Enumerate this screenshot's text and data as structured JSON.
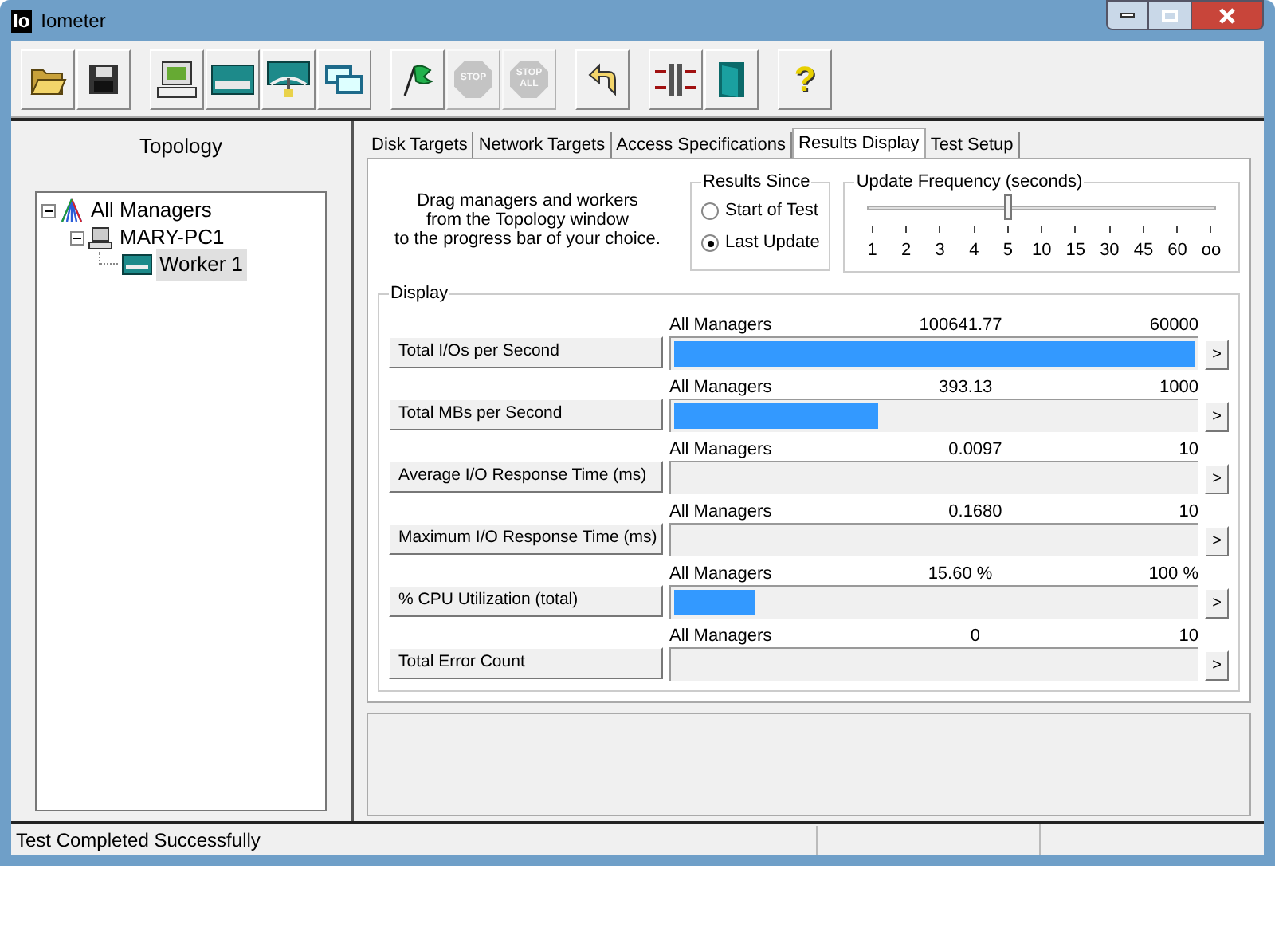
{
  "window": {
    "title": "Iometer",
    "logo": "Io"
  },
  "toolbar": [
    {
      "kind": "open",
      "disabled": false
    },
    {
      "kind": "save",
      "disabled": false
    },
    {
      "kind": "sep"
    },
    {
      "kind": "computer",
      "disabled": false
    },
    {
      "kind": "disk",
      "disabled": false
    },
    {
      "kind": "network",
      "disabled": false
    },
    {
      "kind": "copy",
      "disabled": false
    },
    {
      "kind": "sep"
    },
    {
      "kind": "flag",
      "disabled": false
    },
    {
      "kind": "stop",
      "disabled": true,
      "label": "STOP"
    },
    {
      "kind": "stopall",
      "disabled": true,
      "label": "STOP",
      "label2": "ALL"
    },
    {
      "kind": "sep"
    },
    {
      "kind": "reset",
      "disabled": false
    },
    {
      "kind": "sep"
    },
    {
      "kind": "workers",
      "disabled": false
    },
    {
      "kind": "exit",
      "disabled": false
    },
    {
      "kind": "sep"
    },
    {
      "kind": "help",
      "disabled": false,
      "label": "?"
    }
  ],
  "topology": {
    "title": "Topology",
    "tree": [
      {
        "label": "All Managers",
        "kind": "managers",
        "expanded": true,
        "selected": false,
        "children": [
          {
            "label": "MARY-PC1",
            "kind": "computer",
            "expanded": true,
            "selected": false,
            "children": [
              {
                "label": "Worker 1",
                "kind": "worker",
                "selected": true
              }
            ]
          }
        ]
      }
    ]
  },
  "tabs": [
    {
      "label": "Disk Targets",
      "selected": false
    },
    {
      "label": "Network Targets",
      "selected": false
    },
    {
      "label": "Access Specifications",
      "selected": false
    },
    {
      "label": "Results Display",
      "selected": true
    },
    {
      "label": "Test Setup",
      "selected": false
    }
  ],
  "hint": [
    "Drag managers and workers",
    "from the Topology window",
    "to the progress bar of your choice."
  ],
  "results_since": {
    "title": "Results Since",
    "options": [
      {
        "label": "Start of Test",
        "selected": false
      },
      {
        "label": "Last Update",
        "selected": true
      }
    ]
  },
  "update_frequency": {
    "title": "Update Frequency (seconds)",
    "level": 0.4,
    "ticks": [
      "1",
      "2",
      "3",
      "4",
      "5",
      "10",
      "15",
      "30",
      "45",
      "60",
      "oo"
    ]
  },
  "display": {
    "title": "Display",
    "rows": [
      {
        "label": "Total I/Os per Second",
        "source": "All Managers",
        "value": "100641.77",
        "max": "60000",
        "level": 1.0
      },
      {
        "label": "Total MBs per Second",
        "source": "All Managers",
        "value": "393.13",
        "max": "1000",
        "level": 0.39
      },
      {
        "label": "Average I/O Response Time (ms)",
        "source": "All Managers",
        "value": "0.0097",
        "max": "10"
      },
      {
        "label": "Maximum I/O Response Time (ms)",
        "source": "All Managers",
        "value": "0.1680",
        "max": "10"
      },
      {
        "label": "% CPU Utilization (total)",
        "source": "All Managers",
        "value": "15.60 %",
        "max": "100 %",
        "level": 0.156
      },
      {
        "label": "Total Error Count",
        "source": "All Managers",
        "value": "0",
        "max": "10"
      }
    ],
    "more": ">"
  },
  "status_bar": "Test Completed Successfully"
}
